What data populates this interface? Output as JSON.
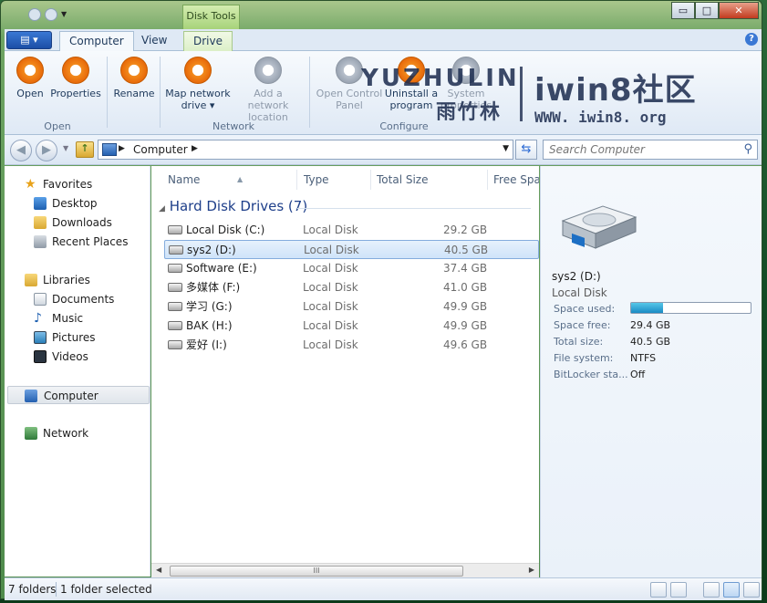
{
  "window": {
    "context_tab": "Disk Tools",
    "buttons": {
      "minimize": "▭",
      "maximize": "□",
      "close": "✕"
    }
  },
  "ribbon_tabs": {
    "computer": "Computer",
    "view": "View",
    "drive": "Drive",
    "help": "?"
  },
  "ribbon": {
    "open": "Open",
    "properties": "Properties",
    "rename": "Rename",
    "map_network_drive": [
      "Map network",
      "drive ▾"
    ],
    "add_network_location": [
      "Add a network",
      "location"
    ],
    "open_control_panel": [
      "Open Control",
      "Panel"
    ],
    "uninstall_program": [
      "Uninstall a",
      "program"
    ],
    "system_properties": [
      "System",
      "properties"
    ],
    "group_open": "Open",
    "group_network": "Network",
    "group_configure": "Configure"
  },
  "watermark": {
    "brand_latin": "YUZHULIN",
    "brand_cn": "雨竹林",
    "site": "iwin8社区",
    "url": "WWW. iwin8. org"
  },
  "address": {
    "path": "Computer",
    "search_placeholder": "Search Computer"
  },
  "nav_pane": {
    "favorites": "Favorites",
    "desktop": "Desktop",
    "downloads": "Downloads",
    "recent": "Recent Places",
    "libraries": "Libraries",
    "documents": "Documents",
    "music": "Music",
    "pictures": "Pictures",
    "videos": "Videos",
    "computer": "Computer",
    "network": "Network"
  },
  "columns": {
    "name": "Name",
    "type": "Type",
    "total": "Total Size",
    "free": "Free Spac"
  },
  "group_header": "Hard Disk Drives (7)",
  "drives": [
    {
      "name": "Local Disk (C:)",
      "type": "Local Disk",
      "size": "29.2 GB"
    },
    {
      "name": "sys2 (D:)",
      "type": "Local Disk",
      "size": "40.5 GB"
    },
    {
      "name": "Software (E:)",
      "type": "Local Disk",
      "size": "37.4 GB"
    },
    {
      "name": "多媒体 (F:)",
      "type": "Local Disk",
      "size": "41.0 GB"
    },
    {
      "name": "学习 (G:)",
      "type": "Local Disk",
      "size": "49.9 GB"
    },
    {
      "name": "BAK (H:)",
      "type": "Local Disk",
      "size": "49.9 GB"
    },
    {
      "name": "爱好 (I:)",
      "type": "Local Disk",
      "size": "49.6 GB"
    }
  ],
  "selected_drive_index": 1,
  "preview": {
    "title": "sys2 (D:)",
    "subtitle": "Local Disk",
    "space_used_label": "Space used:",
    "space_used_fraction": 0.27,
    "space_free_label": "Space free:",
    "space_free": "29.4 GB",
    "total_size_label": "Total size:",
    "total_size": "40.5 GB",
    "fs_label": "File system:",
    "fs": "NTFS",
    "bitlocker_label": "BitLocker sta...",
    "bitlocker": "Off"
  },
  "status": {
    "folders": "7 folders",
    "selected": "1 folder selected"
  },
  "scroll_grip": "III"
}
